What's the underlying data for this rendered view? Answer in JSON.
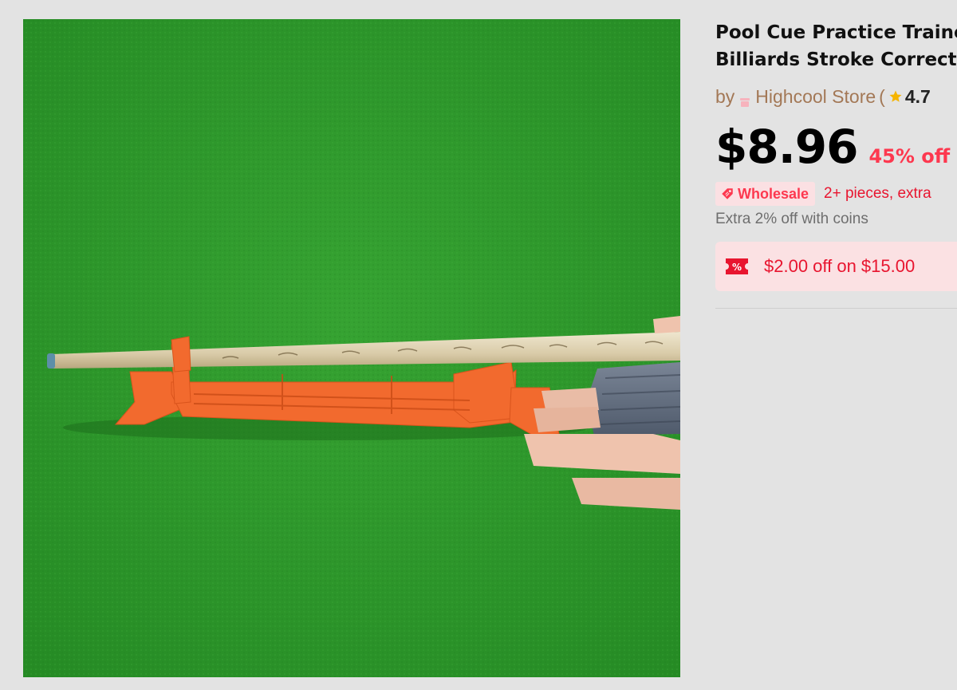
{
  "product": {
    "image_alt": "Pool cue resting on an orange practice trainer on green felt",
    "title_line_1": "Pool Cue Practice Traine",
    "title_line_2": "Billiards Stroke Correcti",
    "store_prefix": "by",
    "store_name": "Highcool Store",
    "store_paren": "(",
    "rating": "4.7",
    "price": "$8.96",
    "discount": "45% off",
    "original_price": "$",
    "wholesale_label": "Wholesale",
    "wholesale_text": "2+ pieces, extra",
    "coins_text": "Extra 2% off with coins",
    "coupon_icon_text": "%",
    "coupon_text": "$2.00 off on $15.00"
  },
  "icons": {
    "store": "store-icon",
    "star": "star-icon",
    "tag": "tag-icon",
    "coupon": "coupon-icon"
  },
  "colors": {
    "accent_red": "#fd384f",
    "store_brown": "#a37856",
    "star_gold": "#f5b400",
    "felt_green": "#2f9a2c",
    "trainer_orange": "#f26a2e"
  }
}
